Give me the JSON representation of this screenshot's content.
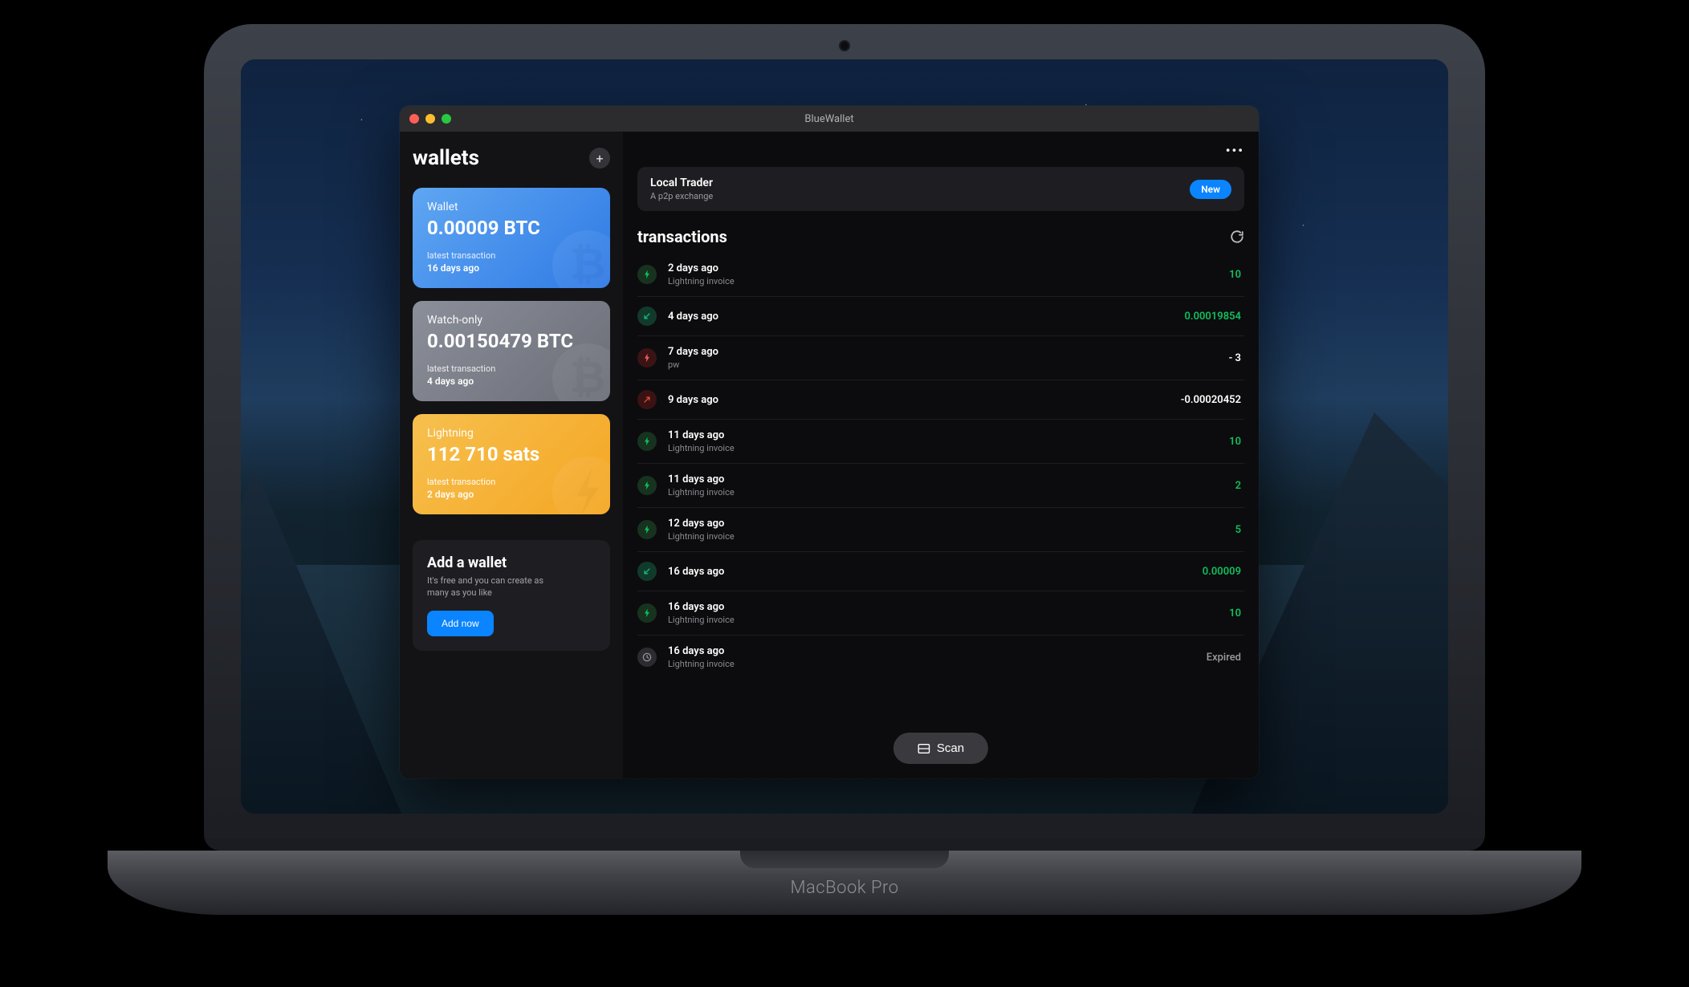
{
  "window": {
    "title": "BlueWallet"
  },
  "laptop": {
    "brand": "MacBook Pro"
  },
  "sidebar": {
    "title": "wallets",
    "add_tooltip": "+",
    "wallets": [
      {
        "name": "Wallet",
        "balance": "0.00009 BTC",
        "meta_label": "latest transaction",
        "meta_value": "16 days ago",
        "style": "blue",
        "icon": "btc"
      },
      {
        "name": "Watch-only",
        "balance": "0.00150479 BTC",
        "meta_label": "latest transaction",
        "meta_value": "4 days ago",
        "style": "gray",
        "icon": "btc"
      },
      {
        "name": "Lightning",
        "balance": "112 710 sats",
        "meta_label": "latest transaction",
        "meta_value": "2 days ago",
        "style": "orange",
        "icon": "bolt"
      }
    ],
    "add_card": {
      "title": "Add a wallet",
      "subtitle": "It's free and you can create as many as you like",
      "button": "Add now"
    }
  },
  "banner": {
    "title": "Local Trader",
    "subtitle": "A p2p exchange",
    "badge": "New"
  },
  "transactions": {
    "title": "transactions",
    "scan_label": "Scan",
    "rows": [
      {
        "icon": "ln-in",
        "time": "2 days ago",
        "sub": "Lightning invoice",
        "amount": "10",
        "amt_class": ""
      },
      {
        "icon": "btc-in",
        "time": "4 days ago",
        "sub": "",
        "amount": "0.00019854",
        "amt_class": ""
      },
      {
        "icon": "ln-out",
        "time": "7 days ago",
        "sub": "pw",
        "amount": "- 3",
        "amt_class": "neg"
      },
      {
        "icon": "btc-out",
        "time": "9 days ago",
        "sub": "",
        "amount": "-0.00020452",
        "amt_class": "neg"
      },
      {
        "icon": "ln-in",
        "time": "11 days ago",
        "sub": "Lightning invoice",
        "amount": "10",
        "amt_class": ""
      },
      {
        "icon": "ln-in",
        "time": "11 days ago",
        "sub": "Lightning invoice",
        "amount": "2",
        "amt_class": ""
      },
      {
        "icon": "ln-in",
        "time": "12 days ago",
        "sub": "Lightning invoice",
        "amount": "5",
        "amt_class": ""
      },
      {
        "icon": "btc-in",
        "time": "16 days ago",
        "sub": "",
        "amount": "0.00009",
        "amt_class": ""
      },
      {
        "icon": "ln-in",
        "time": "16 days ago",
        "sub": "Lightning invoice",
        "amount": "10",
        "amt_class": ""
      },
      {
        "icon": "expired",
        "time": "16 days ago",
        "sub": "Lightning invoice",
        "amount": "Expired",
        "amt_class": "exp"
      }
    ]
  }
}
